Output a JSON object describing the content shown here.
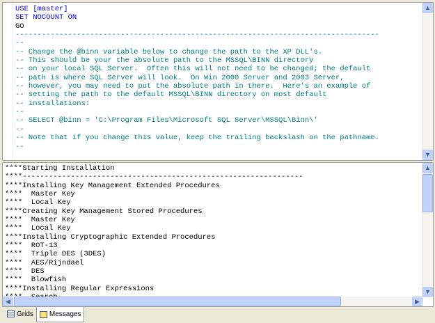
{
  "editor": {
    "lines": [
      {
        "t": "USE [master]",
        "c": "kw"
      },
      {
        "t": "SET NOCOUNT ON",
        "c": "kw"
      },
      {
        "t": "GO",
        "c": "tx"
      },
      {
        "t": "-----------------------------------------------------------------------------------",
        "c": "cm"
      },
      {
        "t": "--",
        "c": "cm"
      },
      {
        "t": "-- Change the @binn variable below to change the path to the XP DLL's.",
        "c": "cm"
      },
      {
        "t": "-- This should be your the absolute path to the MSSQL\\BINN directory",
        "c": "cm"
      },
      {
        "t": "-- on your local SQL Server.  Often this will not need to be changed; the default",
        "c": "cm"
      },
      {
        "t": "-- path is where SQL Server will look.  On Win 2000 Server and 2003 Server,",
        "c": "cm"
      },
      {
        "t": "-- however, you may need to put the absolute path in there.  Here's an example of",
        "c": "cm"
      },
      {
        "t": "-- setting the path to the default MSSQL\\BINN directory on most default",
        "c": "cm"
      },
      {
        "t": "-- installations:",
        "c": "cm"
      },
      {
        "t": "--",
        "c": "cm"
      },
      {
        "t": "-- SELECT @binn = 'C:\\Program Files\\Microsoft SQL Server\\MSSQL\\Binn\\'",
        "c": "cm"
      },
      {
        "t": "--",
        "c": "cm"
      },
      {
        "t": "-- Note that if you change this value, keep the trailing backslash on the pathname.",
        "c": "cm"
      },
      {
        "t": "--",
        "c": "cm"
      }
    ]
  },
  "messages": {
    "lines": [
      "****Starting Installation",
      "****----------------------------------------------------------------",
      "****Installing Key Management Extended Procedures",
      "****  Master Key",
      "****  Local Key",
      "****Creating Key Management Stored Procedures",
      "****  Master Key",
      "****  Local Key",
      "****Installing Cryptographic Extended Procedures",
      "****  ROT-13",
      "****  Triple DES (3DES)",
      "****  AES/Rijndael",
      "****  DES",
      "****  Blowfish",
      "****Installing Regular Expressions",
      "****  Search"
    ]
  },
  "tabs": {
    "grids": "Grids",
    "messages": "Messages"
  }
}
